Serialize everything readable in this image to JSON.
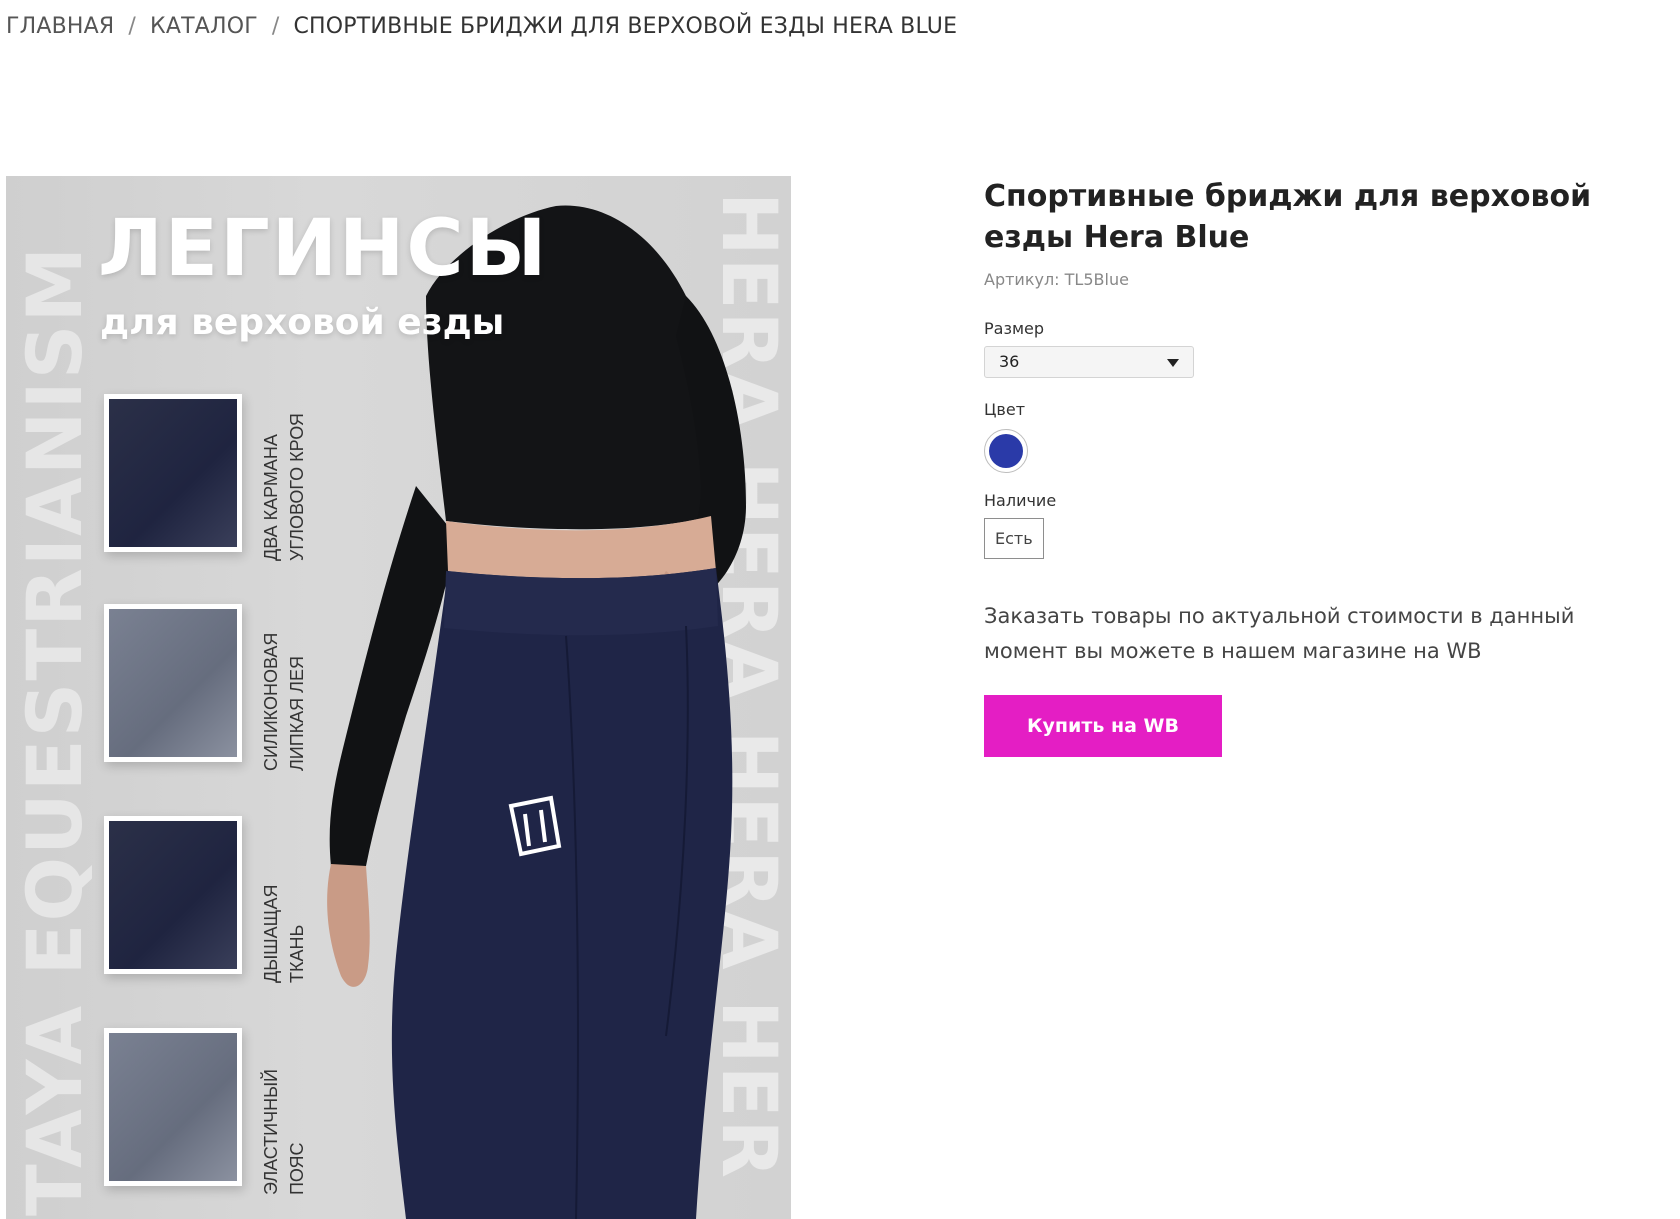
{
  "breadcrumb": {
    "items": [
      "ГЛАВНАЯ",
      "КАТАЛОГ"
    ],
    "separator": "/",
    "current": "СПОРТИВНЫЕ БРИДЖИ ДЛЯ ВЕРХОВОЙ ЕЗДЫ HERA BLUE"
  },
  "product_image": {
    "headline": "ЛЕГИНСЫ",
    "subheadline": "для верховой езды",
    "side_text_left": "TAYA EQUESTRIANISM",
    "side_text_right": "HERA HERA HERA HER",
    "features": [
      {
        "line1": "ДВА КАРМАНА",
        "line2": "УГЛОВОГО КРОЯ"
      },
      {
        "line1": "СИЛИКОНОВАЯ",
        "line2": "ЛИПКАЯ ЛЕЯ"
      },
      {
        "line1": "ДЫШАЩАЯ",
        "line2": "ТКАНЬ"
      },
      {
        "line1": "ЭЛАСТИЧНЫЙ",
        "line2": "ПОЯС"
      }
    ]
  },
  "product": {
    "title": "Спортивные бриджи для верховой езды Hera Blue",
    "sku": "Артикул: TL5Blue",
    "size_label": "Размер",
    "size_value": "36",
    "color_label": "Цвет",
    "color_hex": "#2a3aa8",
    "stock_label": "Наличие",
    "stock_value": "Есть",
    "order_text": "Заказать товары по актуальной стоимости в данный момент вы можете в нашем магазине на WB",
    "buy_label": "Купить на WB",
    "buy_color": "#e41ec4"
  }
}
